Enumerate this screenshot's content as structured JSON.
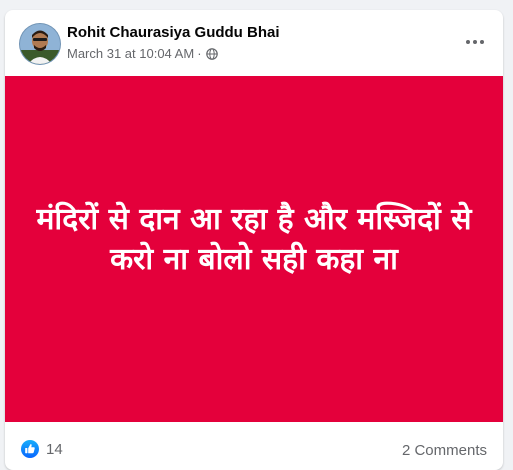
{
  "post": {
    "author": "Rohit Chaurasiya Guddu Bhai",
    "timestamp": "March 31 at 10:04 AM",
    "separator": "·",
    "privacy_icon": "globe-icon",
    "more_icon": "more-horizontal-icon",
    "image_text": "मंदिरों से दान आ रहा है और मस्जिदों से करो ना बोलो सही कहा ना",
    "image_background": "#e4003b",
    "text_color": "#ffffff"
  },
  "footer": {
    "reaction_icon": "like-icon",
    "reaction_color": "#1877f2",
    "reaction_count": "14",
    "comments": "2 Comments"
  }
}
